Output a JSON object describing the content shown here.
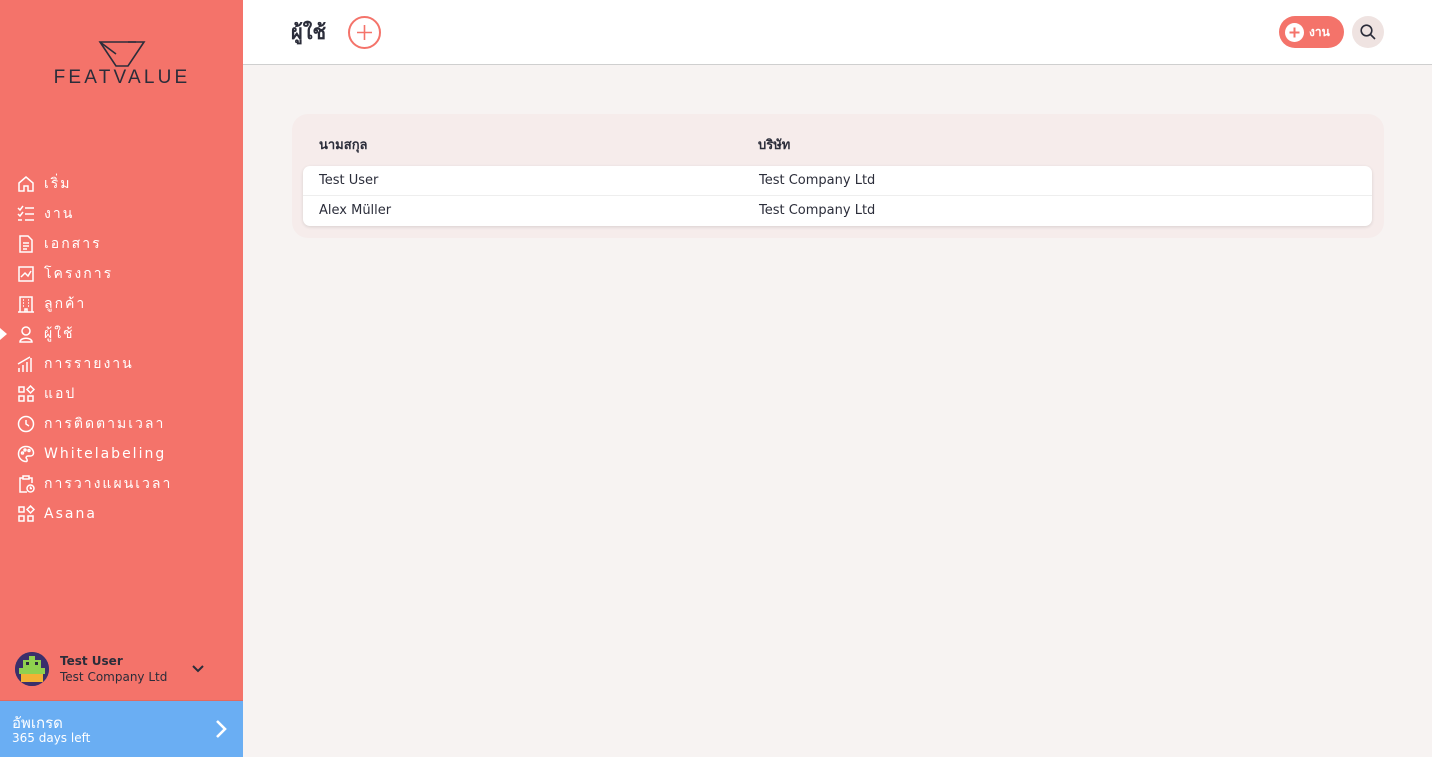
{
  "brand": {
    "logo_text": "FEATVALUE"
  },
  "nav": {
    "items": [
      {
        "label": "เริ่ม",
        "icon": "home-icon"
      },
      {
        "label": "งาน",
        "icon": "checklist-icon"
      },
      {
        "label": "เอกสาร",
        "icon": "document-icon"
      },
      {
        "label": "โครงการ",
        "icon": "chart-icon"
      },
      {
        "label": "ลูกค้า",
        "icon": "building-icon"
      },
      {
        "label": "ผู้ใช้",
        "icon": "user-icon",
        "active": true
      },
      {
        "label": "การรายงาน",
        "icon": "bar-chart-icon"
      },
      {
        "label": "แอป",
        "icon": "apps-icon"
      },
      {
        "label": "การติดตามเวลา",
        "icon": "timer-icon"
      },
      {
        "label": "Whitelabeling",
        "icon": "palette-icon"
      },
      {
        "label": "การวางแผนเวลา",
        "icon": "clipboard-clock-icon"
      },
      {
        "label": "Asana",
        "icon": "apps-icon"
      }
    ]
  },
  "user": {
    "name": "Test User",
    "company": "Test Company Ltd"
  },
  "upgrade": {
    "title": "อัพเกรด",
    "subtitle": "365 days left"
  },
  "header": {
    "title": "ผู้ใช้",
    "task_button_label": "งาน"
  },
  "table": {
    "columns": [
      "นามสกุล",
      "บริษัท"
    ],
    "rows": [
      [
        "Test User",
        "Test Company Ltd"
      ],
      [
        "Alex Müller",
        "Test Company Ltd"
      ]
    ]
  },
  "colors": {
    "accent": "#f4736a",
    "upgrade": "#6aaef3",
    "text": "#2b2d3a",
    "background": "#f7f3f2"
  }
}
